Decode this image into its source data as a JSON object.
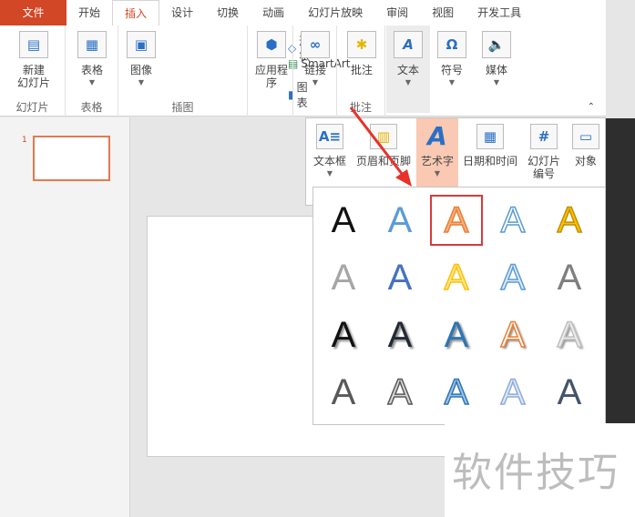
{
  "tabs": [
    "文件",
    "开始",
    "插入",
    "设计",
    "切换",
    "动画",
    "幻灯片放映",
    "审阅",
    "视图",
    "开发工具"
  ],
  "ribbon": {
    "new_slide": "新建\n幻灯片",
    "table": "表格",
    "image": "图像",
    "shape": "形状",
    "smartart": "SmartArt",
    "chart": "图表",
    "apps": "应用程\n序",
    "link": "链接",
    "comment": "批注",
    "text": "文本",
    "symbol": "符号",
    "media": "媒体",
    "groups": {
      "slides": "幻灯片",
      "tables": "表格",
      "illustrations": "插图",
      "comments": "批注"
    }
  },
  "slide_number": "1",
  "text_menu": {
    "textbox": "文本框",
    "header_footer": "页眉和页脚",
    "wordart": "艺术字",
    "datetime": "日期和时间",
    "slide_number": "幻灯片\n编号",
    "object": "对象"
  },
  "wordart": [
    [
      {
        "t": "A",
        "fill": "#111111"
      },
      {
        "t": "A",
        "fill": "#5b9bd5"
      },
      {
        "t": "A",
        "fill": "#f4b183",
        "stroke": "#ed7d31",
        "selected": true
      },
      {
        "t": "A",
        "fill": "#ffffff",
        "stroke": "#5b9bd5"
      },
      {
        "t": "A",
        "fill": "#ffc000",
        "stroke": "#bf9000"
      }
    ],
    [
      {
        "t": "A",
        "fill": "#a6a6a6"
      },
      {
        "t": "A",
        "fill": "#4472c4"
      },
      {
        "t": "A",
        "fill": "#ffe699",
        "stroke": "#ffc000"
      },
      {
        "t": "A",
        "fill": "#deebf7",
        "stroke": "#5b9bd5"
      },
      {
        "t": "A",
        "fill": "#7f7f7f"
      }
    ],
    [
      {
        "t": "A",
        "fill": "#111111"
      },
      {
        "t": "A",
        "fill": "#222a35"
      },
      {
        "t": "A",
        "fill": "#2e75b6"
      },
      {
        "t": "A",
        "fill": "#ffffff",
        "stroke": "#ed7d31"
      },
      {
        "t": "A",
        "fill": "#ededed",
        "stroke": "#bfbfbf"
      }
    ],
    [
      {
        "t": "A",
        "fill": "#595959"
      },
      {
        "t": "A",
        "fill": "#d9d9d9",
        "stroke": "#595959"
      },
      {
        "t": "A",
        "fill": "#9dc3e6",
        "stroke": "#2e75b6"
      },
      {
        "t": "A",
        "fill": "#ddebf7",
        "stroke": "#8faadc"
      },
      {
        "t": "A",
        "fill": "#44546a"
      }
    ]
  ],
  "watermark": "软件技巧"
}
